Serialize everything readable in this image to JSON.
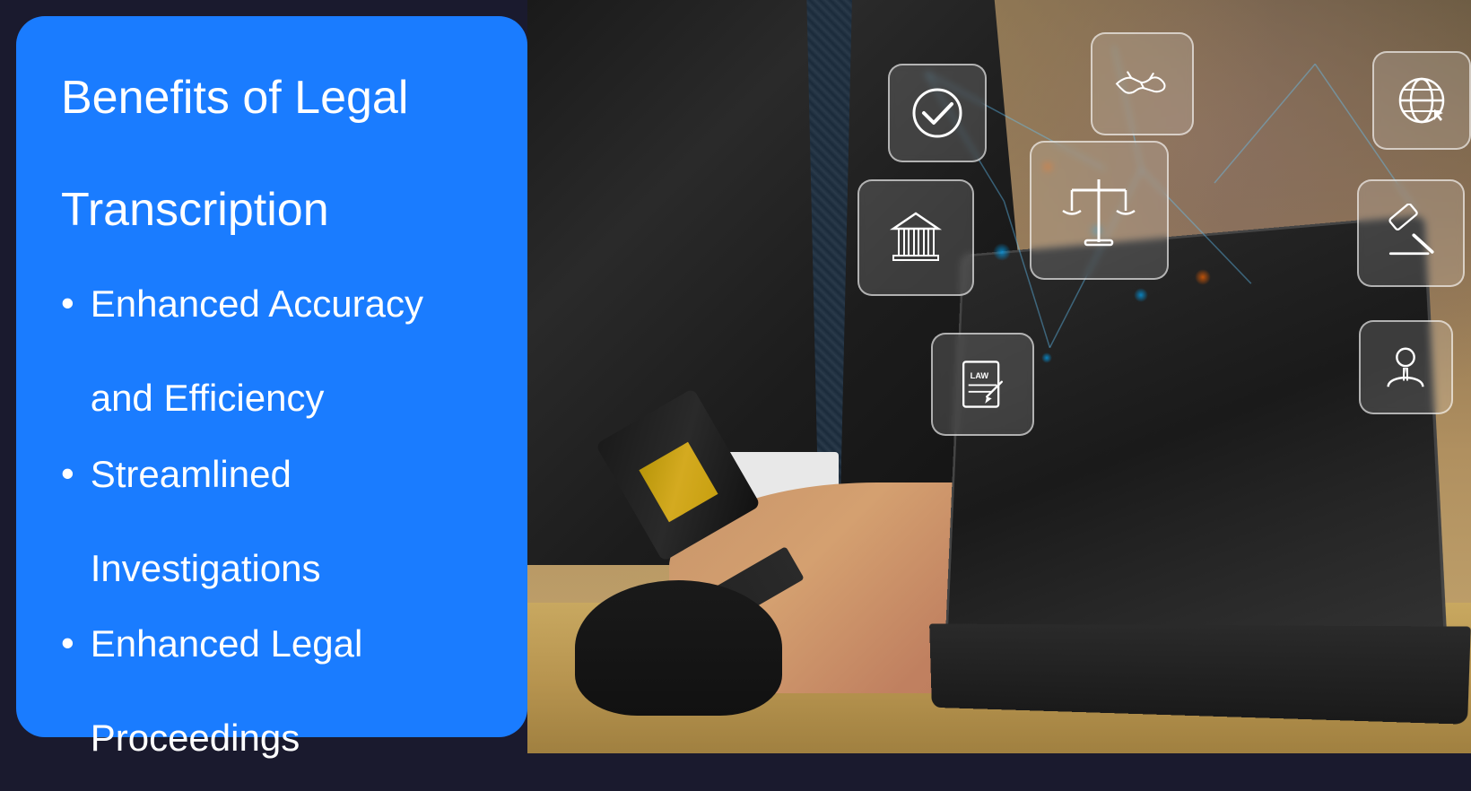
{
  "leftPanel": {
    "title": "Benefits of Legal\n\nTranscription",
    "titleLine1": "Benefits of Legal",
    "titleLine2": "Transcription",
    "benefits": [
      {
        "id": "benefit-accuracy",
        "bullet": "•",
        "textLine1": "Enhanced Accuracy",
        "textLine2": "and Efficiency"
      },
      {
        "id": "benefit-investigations",
        "bullet": "•",
        "textLine1": "Streamlined",
        "textLine2": "Investigations"
      },
      {
        "id": "benefit-legal",
        "bullet": "•",
        "textLine1": "Enhanced Legal",
        "textLine2": "Proceedings"
      }
    ],
    "backgroundColor": "#1a7cff"
  },
  "rightPanel": {
    "altText": "Lawyer using laptop with legal icons floating above keyboard",
    "icons": [
      {
        "id": "check-icon",
        "label": "Checkmark"
      },
      {
        "id": "handshake-icon",
        "label": "Handshake"
      },
      {
        "id": "globe-icon",
        "label": "Globe"
      },
      {
        "id": "building-icon",
        "label": "Court Building"
      },
      {
        "id": "scales-icon",
        "label": "Scales of Justice"
      },
      {
        "id": "gavel-float-icon",
        "label": "Gavel"
      },
      {
        "id": "law-doc-icon",
        "label": "Law Document"
      },
      {
        "id": "person-icon",
        "label": "Person"
      }
    ]
  }
}
